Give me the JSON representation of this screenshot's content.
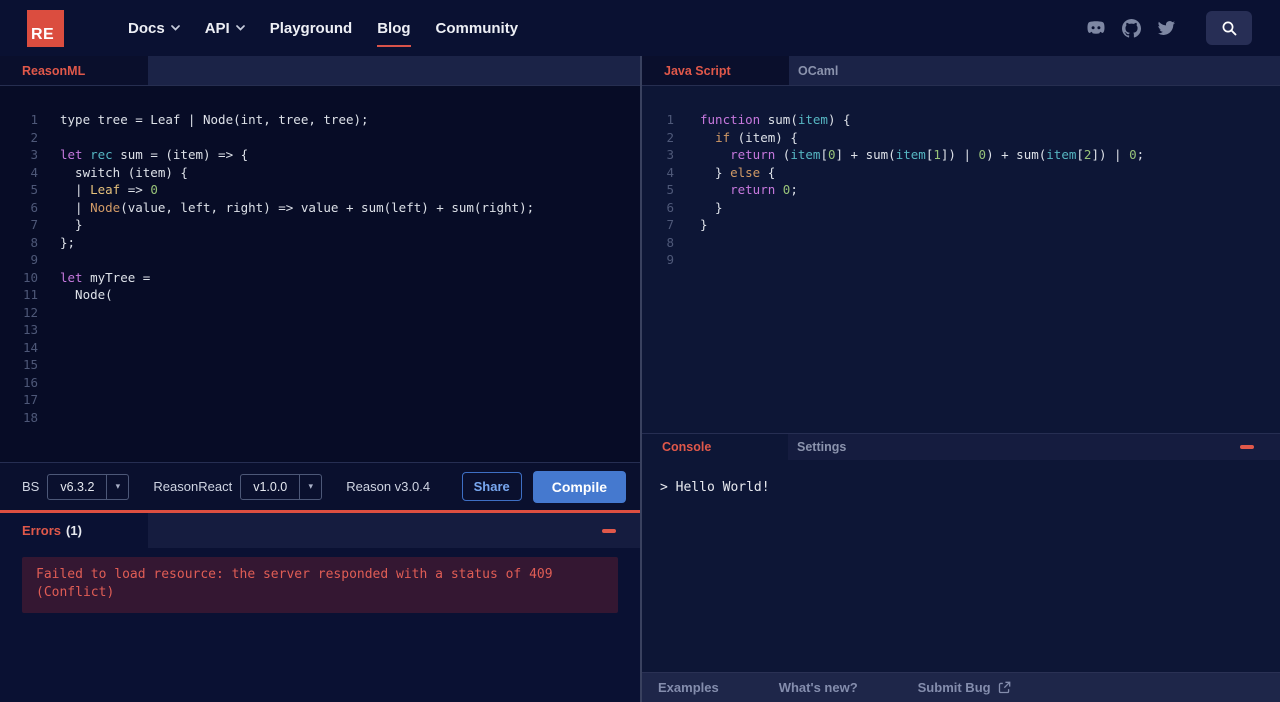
{
  "colors": {
    "accent_red": "#e0584a",
    "brand_red": "#db4d3f",
    "compile_blue": "#4579cf",
    "error_text": "#e05d55",
    "syntax": {
      "plain": "#dde1e8",
      "kw": "#c678dd",
      "ident": "#56b6c2",
      "ctor": "#d19a66",
      "variant": "#e5c07b",
      "num": "#98c379"
    }
  },
  "navbar": {
    "logo_text": "RE",
    "items": [
      {
        "label": "Docs",
        "caret": true
      },
      {
        "label": "API",
        "caret": true
      },
      {
        "label": "Playground",
        "caret": false
      },
      {
        "label": "Blog",
        "caret": false,
        "active": true
      },
      {
        "label": "Community",
        "caret": false
      }
    ],
    "icons": [
      "discord-icon",
      "github-icon",
      "twitter-icon",
      "search-icon"
    ]
  },
  "left_panel": {
    "tab_label": "ReasonML",
    "code_lines": [
      [
        [
          "plain",
          "type tree = Leaf | Node(int, tree, tree);"
        ]
      ],
      [],
      [
        [
          "kw",
          "let"
        ],
        [
          "plain",
          " "
        ],
        [
          "ident",
          "rec"
        ],
        [
          "plain",
          " sum = (item) => {"
        ]
      ],
      [
        [
          "plain",
          "  switch (item) {"
        ]
      ],
      [
        [
          "plain",
          "  | "
        ],
        [
          "variant",
          "Leaf"
        ],
        [
          "plain",
          " => "
        ],
        [
          "num",
          "0"
        ]
      ],
      [
        [
          "plain",
          "  | "
        ],
        [
          "ctor",
          "Node"
        ],
        [
          "plain",
          "(value, left, right) => value + sum(left) + sum(right);"
        ]
      ],
      [
        [
          "plain",
          "  }"
        ]
      ],
      [
        [
          "plain",
          "};"
        ]
      ],
      [],
      [
        [
          "kw",
          "let"
        ],
        [
          "plain",
          " myTree ="
        ]
      ],
      [
        [
          "plain",
          "  Node("
        ]
      ],
      [],
      [],
      [],
      [],
      [],
      [],
      []
    ],
    "toolbar": {
      "bs_label": "BS",
      "bs_version": "v6.3.2",
      "reasonreact_label": "ReasonReact",
      "reasonreact_version": "v1.0.0",
      "reason_version_text": "Reason v3.0.4",
      "share_label": "Share",
      "compile_label": "Compile"
    },
    "errors": {
      "title": "Errors",
      "count": "(1)",
      "message": "Failed to load resource: the server responded with a status of 409 (Conflict)"
    }
  },
  "right_panel": {
    "tabs": [
      {
        "label": "Java Script",
        "active": true
      },
      {
        "label": "OCaml",
        "active": false
      }
    ],
    "code_lines": [
      [
        [
          "kw",
          "function"
        ],
        [
          "plain",
          " sum("
        ],
        [
          "ident",
          "item"
        ],
        [
          "plain",
          ") {"
        ]
      ],
      [
        [
          "plain",
          "  "
        ],
        [
          "ctor",
          "if"
        ],
        [
          "plain",
          " (item) {"
        ]
      ],
      [
        [
          "plain",
          "    "
        ],
        [
          "kw",
          "return"
        ],
        [
          "plain",
          " ("
        ],
        [
          "ident",
          "item"
        ],
        [
          "plain",
          "["
        ],
        [
          "num",
          "0"
        ],
        [
          "plain",
          "] + sum("
        ],
        [
          "ident",
          "item"
        ],
        [
          "plain",
          "["
        ],
        [
          "num",
          "1"
        ],
        [
          "plain",
          "]) | "
        ],
        [
          "num",
          "0"
        ],
        [
          "plain",
          ") + sum("
        ],
        [
          "ident",
          "item"
        ],
        [
          "plain",
          "["
        ],
        [
          "num",
          "2"
        ],
        [
          "plain",
          "]) | "
        ],
        [
          "num",
          "0"
        ],
        [
          "plain",
          ";"
        ]
      ],
      [
        [
          "plain",
          "  } "
        ],
        [
          "ctor",
          "else"
        ],
        [
          "plain",
          " {"
        ]
      ],
      [
        [
          "plain",
          "    "
        ],
        [
          "kw",
          "return"
        ],
        [
          "plain",
          " "
        ],
        [
          "num",
          "0"
        ],
        [
          "plain",
          ";"
        ]
      ],
      [
        [
          "plain",
          "  }"
        ]
      ],
      [
        [
          "plain",
          "}"
        ]
      ],
      [],
      []
    ],
    "console": {
      "tabs": [
        {
          "label": "Console",
          "active": true
        },
        {
          "label": "Settings",
          "active": false
        }
      ],
      "output": "> Hello World!"
    },
    "footer_links": [
      "Examples",
      "What's new?",
      "Submit Bug"
    ]
  }
}
